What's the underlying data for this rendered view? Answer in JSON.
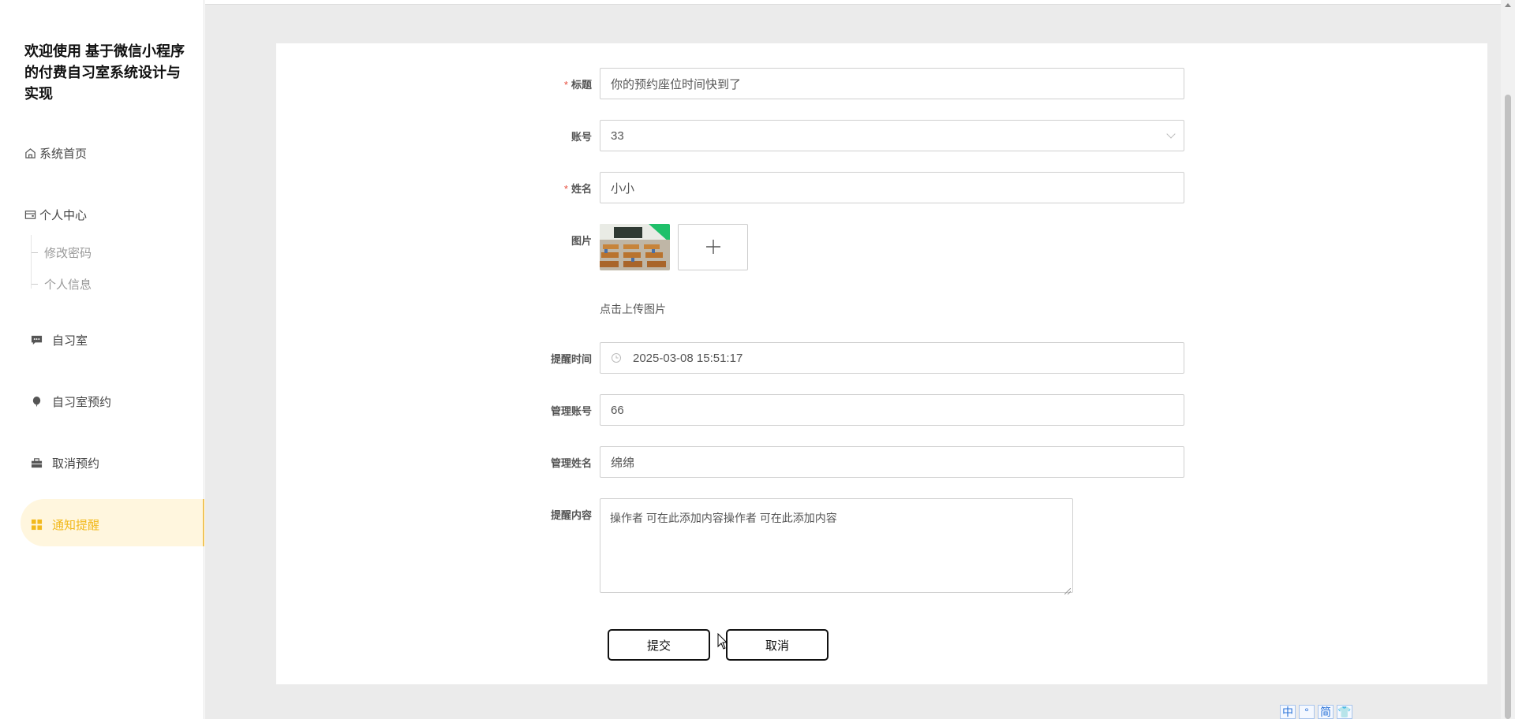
{
  "sidebar": {
    "brand": "欢迎使用 基于微信小程序的付费自习室系统设计与实现",
    "home": "系统首页",
    "personal_center": "个人中心",
    "sub_items": [
      "修改密码",
      "个人信息"
    ],
    "items": [
      "自习室",
      "自习室预约",
      "取消预约",
      "通知提醒"
    ],
    "active_item": "通知提醒"
  },
  "form": {
    "title": {
      "label": "标题",
      "value": "你的预约座位时间快到了",
      "required": "*"
    },
    "account": {
      "label": "账号",
      "value": "33"
    },
    "name": {
      "label": "姓名",
      "value": "小小",
      "required": "*"
    },
    "image": {
      "label": "图片",
      "upload_hint": "点击上传图片"
    },
    "remind_time": {
      "label": "提醒时间",
      "value": "2025-03-08 15:51:17"
    },
    "manager_account": {
      "label": "管理账号",
      "value": "66"
    },
    "manager_name": {
      "label": "管理姓名",
      "value": "绵绵"
    },
    "content": {
      "label": "提醒内容",
      "value": "操作者  可在此添加内容操作者  可在此添加内容"
    }
  },
  "buttons": {
    "submit": "提交",
    "cancel": "取消"
  },
  "ime": [
    "中",
    "°",
    "简",
    "👕"
  ],
  "colors": {
    "accent": "#f2b91c",
    "active_bg": "#fff6de",
    "required": "#e74c3c",
    "main_bg": "#ebebeb"
  }
}
